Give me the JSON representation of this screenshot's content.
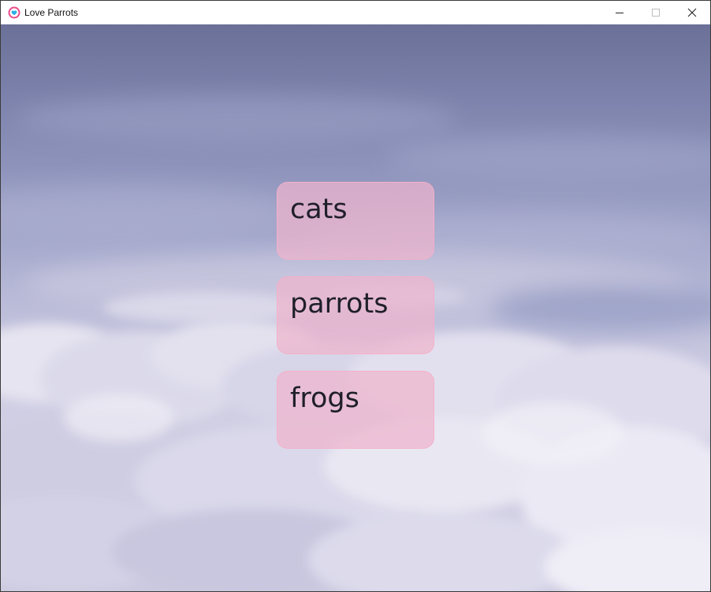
{
  "window": {
    "title": "Love Parrots",
    "icon": "heart-app-icon",
    "controls": {
      "minimize": "minimize-icon",
      "maximize": "maximize-icon",
      "close": "close-icon"
    }
  },
  "background": {
    "type": "cloudy-sky-image"
  },
  "menu": {
    "buttons": [
      {
        "label": "cats"
      },
      {
        "label": "parrots"
      },
      {
        "label": "frogs"
      }
    ]
  },
  "colors": {
    "button_fill": "#eeb4cd",
    "button_border": "#f5afc8",
    "button_text": "#1f1f2a",
    "sky_top": "#6b7098",
    "sky_bottom": "#cbc9df"
  }
}
